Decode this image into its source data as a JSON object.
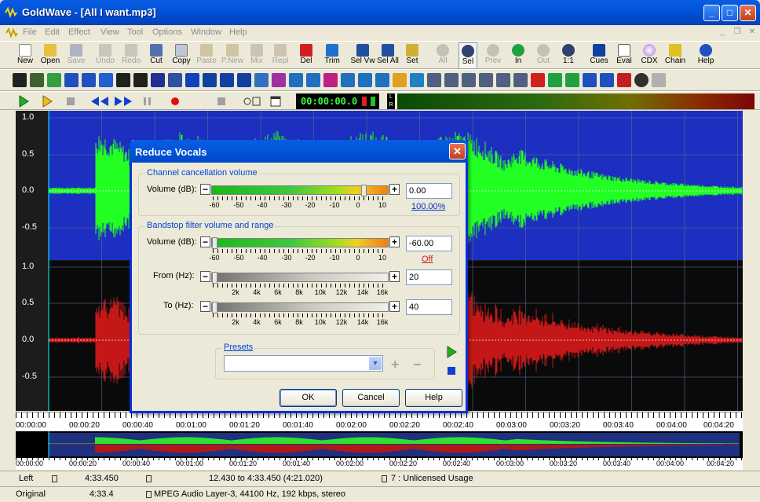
{
  "window": {
    "title": "GoldWave - [All I want.mp3]",
    "min": "_",
    "max": "□",
    "close": "✕"
  },
  "menu": [
    "File",
    "Edit",
    "Effect",
    "View",
    "Tool",
    "Options",
    "Window",
    "Help"
  ],
  "toolbar1": [
    {
      "label": "New",
      "enabled": true
    },
    {
      "label": "Open",
      "enabled": true
    },
    {
      "label": "Save",
      "enabled": false
    },
    {
      "label": "Undo",
      "enabled": false
    },
    {
      "label": "Redo",
      "enabled": false
    },
    {
      "label": "Cut",
      "enabled": true
    },
    {
      "label": "Copy",
      "enabled": true
    },
    {
      "label": "Paste",
      "enabled": false
    },
    {
      "label": "P.New",
      "enabled": false
    },
    {
      "label": "Mix",
      "enabled": false
    },
    {
      "label": "Repl",
      "enabled": false
    },
    {
      "label": "Del",
      "enabled": true
    },
    {
      "label": "Trim",
      "enabled": true
    },
    {
      "label": "Sel Vw",
      "enabled": true
    },
    {
      "label": "Sel All",
      "enabled": true
    },
    {
      "label": "Set",
      "enabled": true
    },
    {
      "label": "All",
      "enabled": false
    },
    {
      "label": "Sel",
      "enabled": true
    },
    {
      "label": "Prev",
      "enabled": false
    },
    {
      "label": "In",
      "enabled": true
    },
    {
      "label": "Out",
      "enabled": false
    },
    {
      "label": "1:1",
      "enabled": true
    },
    {
      "label": "Cues",
      "enabled": true
    },
    {
      "label": "Eval",
      "enabled": true
    },
    {
      "label": "CDX",
      "enabled": true
    },
    {
      "label": "Chain",
      "enabled": true
    },
    {
      "label": "Help",
      "enabled": true
    }
  ],
  "timer": "00:00:00.0",
  "lr_label": "L R",
  "waveform": {
    "y_labels": [
      "1.0",
      "0.5",
      "0.0",
      "-0.5"
    ],
    "colors": {
      "left": "#22ff22",
      "right": "#c41818",
      "left_bg": "#1d2fc0",
      "right_bg": "#0a0a0a"
    }
  },
  "timeline": [
    "00:00:00",
    "00:00:20",
    "00:00:40",
    "00:01:00",
    "00:01:20",
    "00:01:40",
    "00:02:00",
    "00:02:20",
    "00:02:40",
    "00:03:00",
    "00:03:20",
    "00:03:40",
    "00:04:00",
    "00:04:20"
  ],
  "status": {
    "row1": {
      "channel": "Left",
      "length": "4:33.450",
      "selection": "12.430 to 4:33.450 (4:21.020)",
      "license": "7 : Unlicensed Usage"
    },
    "row2": {
      "mode": "Original",
      "length": "4:33.4",
      "format": "MPEG Audio Layer-3, 44100 Hz, 192 kbps, stereo"
    }
  },
  "dialog": {
    "title": "Reduce Vocals",
    "group1": {
      "title": "Channel cancellation volume",
      "volume_label": "Volume (dB):",
      "value": "0.00",
      "extra": "100.00%",
      "ticks": [
        "-60",
        "-50",
        "-40",
        "-30",
        "-20",
        "-10",
        "0",
        "10"
      ],
      "level": 0.0
    },
    "group2": {
      "title": "Bandstop filter volume and range",
      "volume_label": "Volume (dB):",
      "volume_value": "-60.00",
      "volume_extra": "Off",
      "volume_ticks": [
        "-60",
        "-50",
        "-40",
        "-30",
        "-20",
        "-10",
        "0",
        "10"
      ],
      "from_label": "From (Hz):",
      "from_value": "20",
      "to_label": "To (Hz):",
      "to_value": "40",
      "hz_ticks": [
        "2k",
        "4k",
        "6k",
        "8k",
        "10k",
        "12k",
        "14k",
        "16k"
      ]
    },
    "presets_label": "Presets",
    "preset_value": "",
    "buttons": {
      "ok": "OK",
      "cancel": "Cancel",
      "help": "Help"
    },
    "preset_add": "+",
    "preset_remove": "−"
  }
}
